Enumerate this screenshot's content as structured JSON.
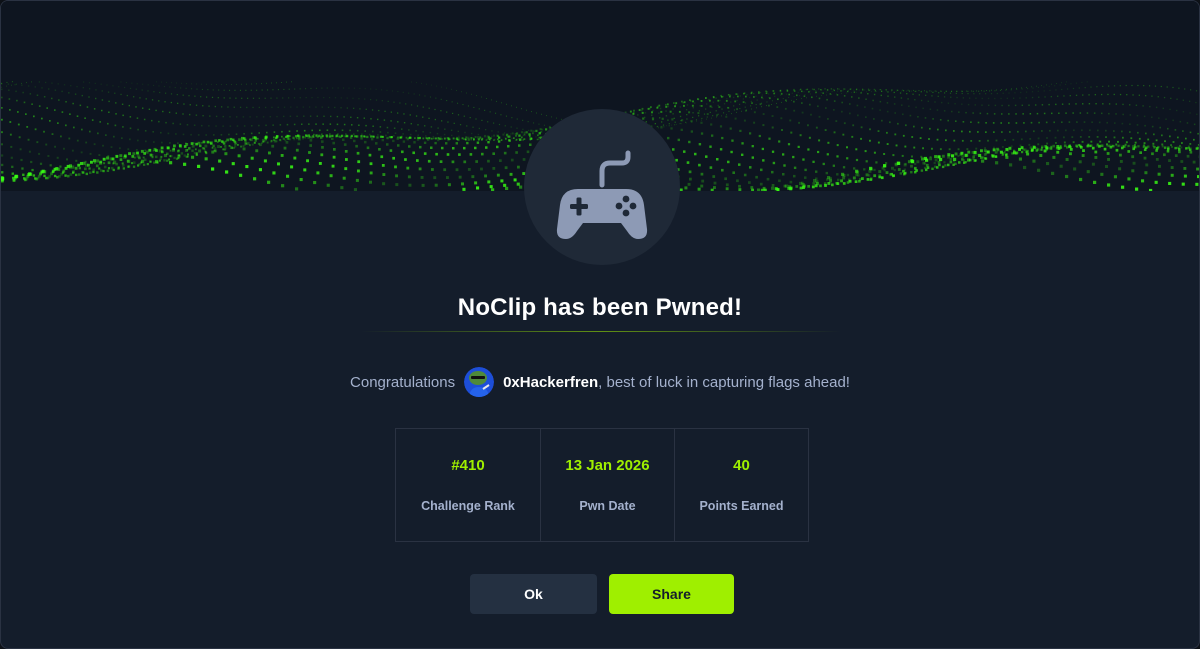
{
  "dialog": {
    "title": "NoClip has been Pwned!",
    "icon": "gamepad-icon",
    "banner_style": "green-digital-wave"
  },
  "congrats": {
    "prefix": "Congratulations",
    "username": "0xHackerfren",
    "suffix": ", best of luck in capturing flags ahead!",
    "avatar_icon": "user-avatar"
  },
  "stats": [
    {
      "value": "#410",
      "label": "Challenge Rank"
    },
    {
      "value": "13 Jan 2026",
      "label": "Pwn Date"
    },
    {
      "value": "40",
      "label": "Points Earned"
    }
  ],
  "buttons": {
    "ok": "Ok",
    "share": "Share"
  },
  "colors": {
    "background": "#141d2b",
    "accent": "#9fef00",
    "muted_text": "#a4b1cd",
    "panel": "#1f2937"
  }
}
